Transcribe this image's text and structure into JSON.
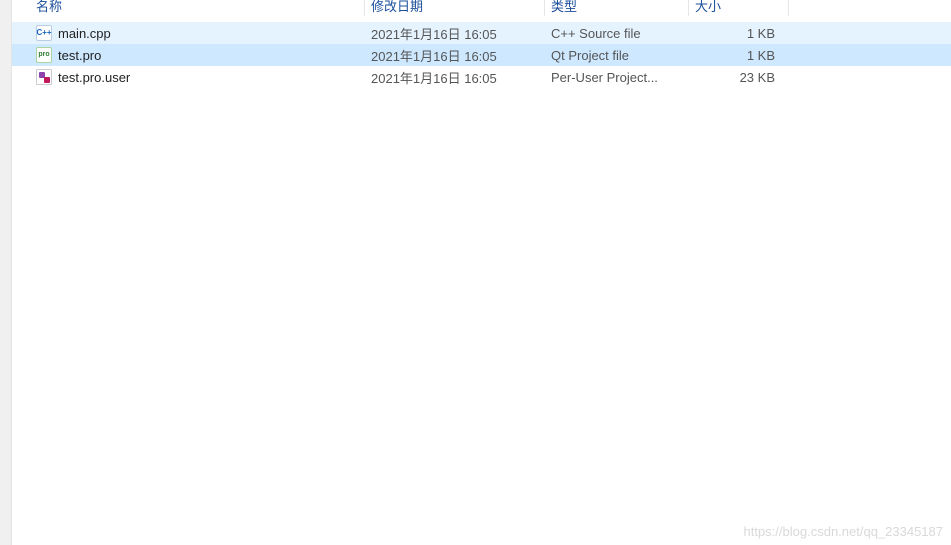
{
  "columns": {
    "name": "名称",
    "date": "修改日期",
    "type": "类型",
    "size": "大小"
  },
  "files": [
    {
      "name": "main.cpp",
      "date": "2021年1月16日 16:05",
      "type": "C++ Source file",
      "size": "1 KB",
      "icon": "cpp",
      "state": "hover"
    },
    {
      "name": "test.pro",
      "date": "2021年1月16日 16:05",
      "type": "Qt Project file",
      "size": "1 KB",
      "icon": "pro",
      "state": "selected"
    },
    {
      "name": "test.pro.user",
      "date": "2021年1月16日 16:05",
      "type": "Per-User Project...",
      "size": "23 KB",
      "icon": "user",
      "state": "normal"
    }
  ],
  "icon_labels": {
    "cpp": "C++",
    "pro": "pro"
  },
  "watermark": "https://blog.csdn.net/qq_23345187"
}
